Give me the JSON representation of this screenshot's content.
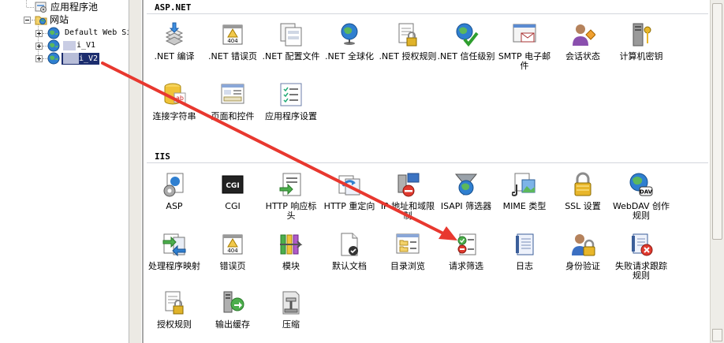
{
  "tree": {
    "app_pools": "应用程序池",
    "sites": "网站",
    "site1": "Default Web Si",
    "site2_suffix": "i_V1",
    "site3_suffix": "i_V2"
  },
  "groups": {
    "aspnet": "ASP.NET",
    "iis": "IIS"
  },
  "aspnet_features": [
    {
      "label": ".NET 编译"
    },
    {
      "label": ".NET 错误页"
    },
    {
      "label": ".NET 配置文件"
    },
    {
      "label": ".NET 全球化"
    },
    {
      "label": ".NET 授权规则"
    },
    {
      "label": ".NET 信任级别"
    },
    {
      "label": "SMTP 电子邮件"
    },
    {
      "label": "会话状态"
    },
    {
      "label": "计算机密钥"
    },
    {
      "label": "连接字符串"
    },
    {
      "label": "页面和控件"
    },
    {
      "label": "应用程序设置"
    }
  ],
  "iis_features": [
    {
      "label": "ASP"
    },
    {
      "label": "CGI"
    },
    {
      "label": "HTTP 响应标头"
    },
    {
      "label": "HTTP 重定向"
    },
    {
      "label": "IP 地址和域限制"
    },
    {
      "label": "ISAPI 筛选器"
    },
    {
      "label": "MIME 类型"
    },
    {
      "label": "SSL 设置"
    },
    {
      "label": "WebDAV 创作规则"
    },
    {
      "label": "处理程序映射"
    },
    {
      "label": "错误页"
    },
    {
      "label": "模块"
    },
    {
      "label": "默认文档"
    },
    {
      "label": "目录浏览"
    },
    {
      "label": "请求筛选"
    },
    {
      "label": "日志"
    },
    {
      "label": "身份验证"
    },
    {
      "label": "失败请求跟踪规则"
    },
    {
      "label": "授权规则"
    },
    {
      "label": "输出缓存"
    },
    {
      "label": "压缩"
    }
  ],
  "icon_texts": {
    "err404": "404",
    "cgi": "CGI",
    "dav": "DAV",
    "ab": "ab"
  },
  "colors": {
    "annotation_arrow": "#e8382f",
    "selection": "#1c2d6e"
  }
}
